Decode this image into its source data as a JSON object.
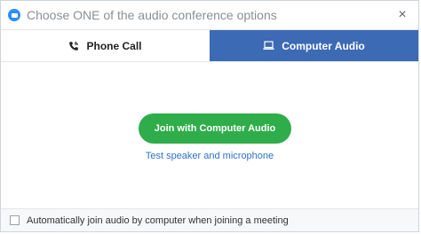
{
  "window": {
    "title": "Choose ONE of the audio conference options",
    "close_glyph": "×",
    "app_icon": "zoom-camera-icon"
  },
  "tabs": [
    {
      "label": "Phone Call",
      "icon": "phone-icon",
      "selected": false
    },
    {
      "label": "Computer Audio",
      "icon": "laptop-icon",
      "selected": true
    }
  ],
  "main": {
    "join_button_label": "Join with Computer Audio",
    "test_link_label": "Test speaker and microphone"
  },
  "footer": {
    "checkbox_checked": false,
    "checkbox_label": "Automatically join audio by computer when joining a meeting"
  },
  "colors": {
    "selected_tab": "#3c6ab4",
    "join_button": "#2fad4a",
    "link": "#2f72c4",
    "app_icon": "#2d8cff"
  }
}
